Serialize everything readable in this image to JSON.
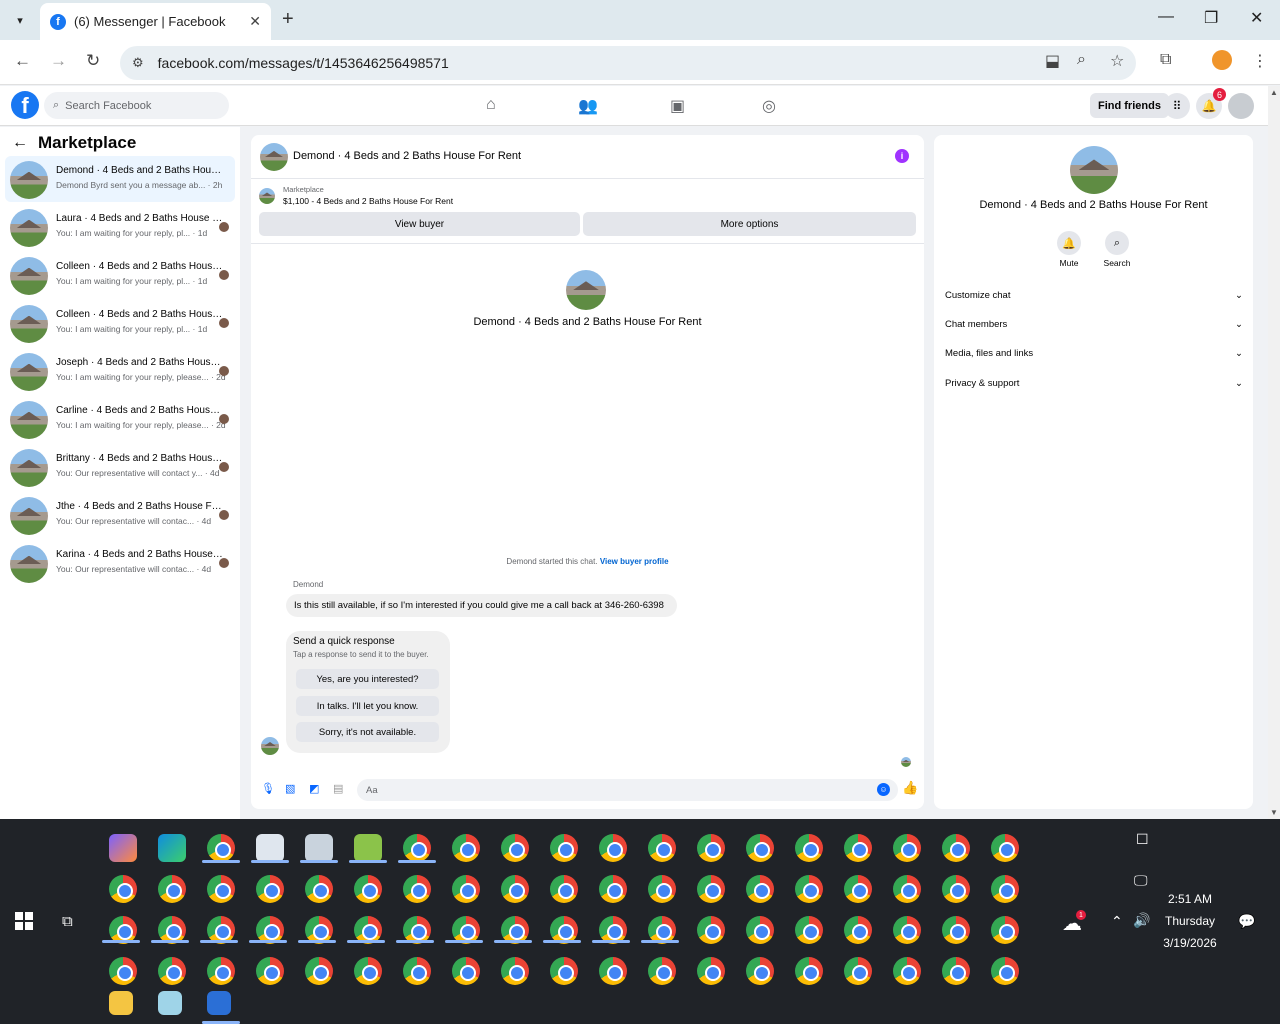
{
  "browser": {
    "tab_title": "(6) Messenger | Facebook",
    "tab_icon": "facebook-icon",
    "url": "facebook.com/messages/t/1453646256498571"
  },
  "fb": {
    "search_placeholder": "Search Facebook",
    "find_friends": "Find friends",
    "notification_count": "6",
    "nav_icons": [
      "home-icon",
      "friends-icon",
      "marketplace-icon",
      "groups-icon"
    ]
  },
  "sidebar": {
    "title": "Marketplace",
    "conversations": [
      {
        "name": "Demond · 4 Beds and 2 Baths House For Rent",
        "snippet": "Demond Byrd sent you a message ab... · 2h",
        "active": true
      },
      {
        "name": "Laura · 4 Beds and 2 Baths House For Rent",
        "snippet": "You: I am waiting for your reply, pl... · 1d"
      },
      {
        "name": "Colleen · 4 Beds and 2 Baths House For Rent",
        "snippet": "You: I am waiting for your reply, pl... · 1d"
      },
      {
        "name": "Colleen · 4 Beds and 2 Baths House For Rent",
        "snippet": "You: I am waiting for your reply, pl... · 1d"
      },
      {
        "name": "Joseph · 4 Beds and 2 Baths House For Rent",
        "snippet": "You: I am waiting for your reply, please... · 2d"
      },
      {
        "name": "Carline · 4 Beds and 2 Baths House For Rent",
        "snippet": "You: I am waiting for your reply, please... · 2d"
      },
      {
        "name": "Brittany · 4 Beds and 2 Baths House For Rent",
        "snippet": "You: Our representative will contact y... · 4d"
      },
      {
        "name": "Jthe · 4 Beds and 2 Baths House For Rent",
        "snippet": "You: Our representative will contac... · 4d"
      },
      {
        "name": "Karina · 4 Beds and 2 Baths House For Rent",
        "snippet": "You: Our representative will contac... · 4d"
      }
    ]
  },
  "chat": {
    "title": "Demond · 4 Beds and 2 Baths House For Rent",
    "marketplace_label": "Marketplace",
    "listing": "$1,100 - 4 Beds and 2 Baths House For Rent",
    "view_buyer": "View buyer",
    "more_options": "More options",
    "center_title": "Demond · 4 Beds and 2 Baths House For Rent",
    "started_text": "Demond started this chat.",
    "view_buyer_profile": "View buyer profile",
    "sender": "Demond",
    "message": "Is this still available, if so I'm interested if you could give me a call back at 346-260-6398",
    "quick_title": "Send a quick response",
    "quick_sub": "Tap a response to send it to the buyer.",
    "quick_responses": [
      "Yes, are you interested?",
      "In talks. I'll let you know.",
      "Sorry, it's not available."
    ],
    "compose_placeholder": "Aa"
  },
  "details": {
    "title": "Demond · 4 Beds and 2 Baths House For Rent",
    "mute": "Mute",
    "search": "Search",
    "sections": [
      "Customize chat",
      "Chat members",
      "Media, files and links",
      "Privacy & support"
    ]
  },
  "taskbar": {
    "time": "2:51 AM",
    "day": "Thursday",
    "date": "3/19/2026",
    "weather_badge": "1",
    "notification_count": "1"
  }
}
